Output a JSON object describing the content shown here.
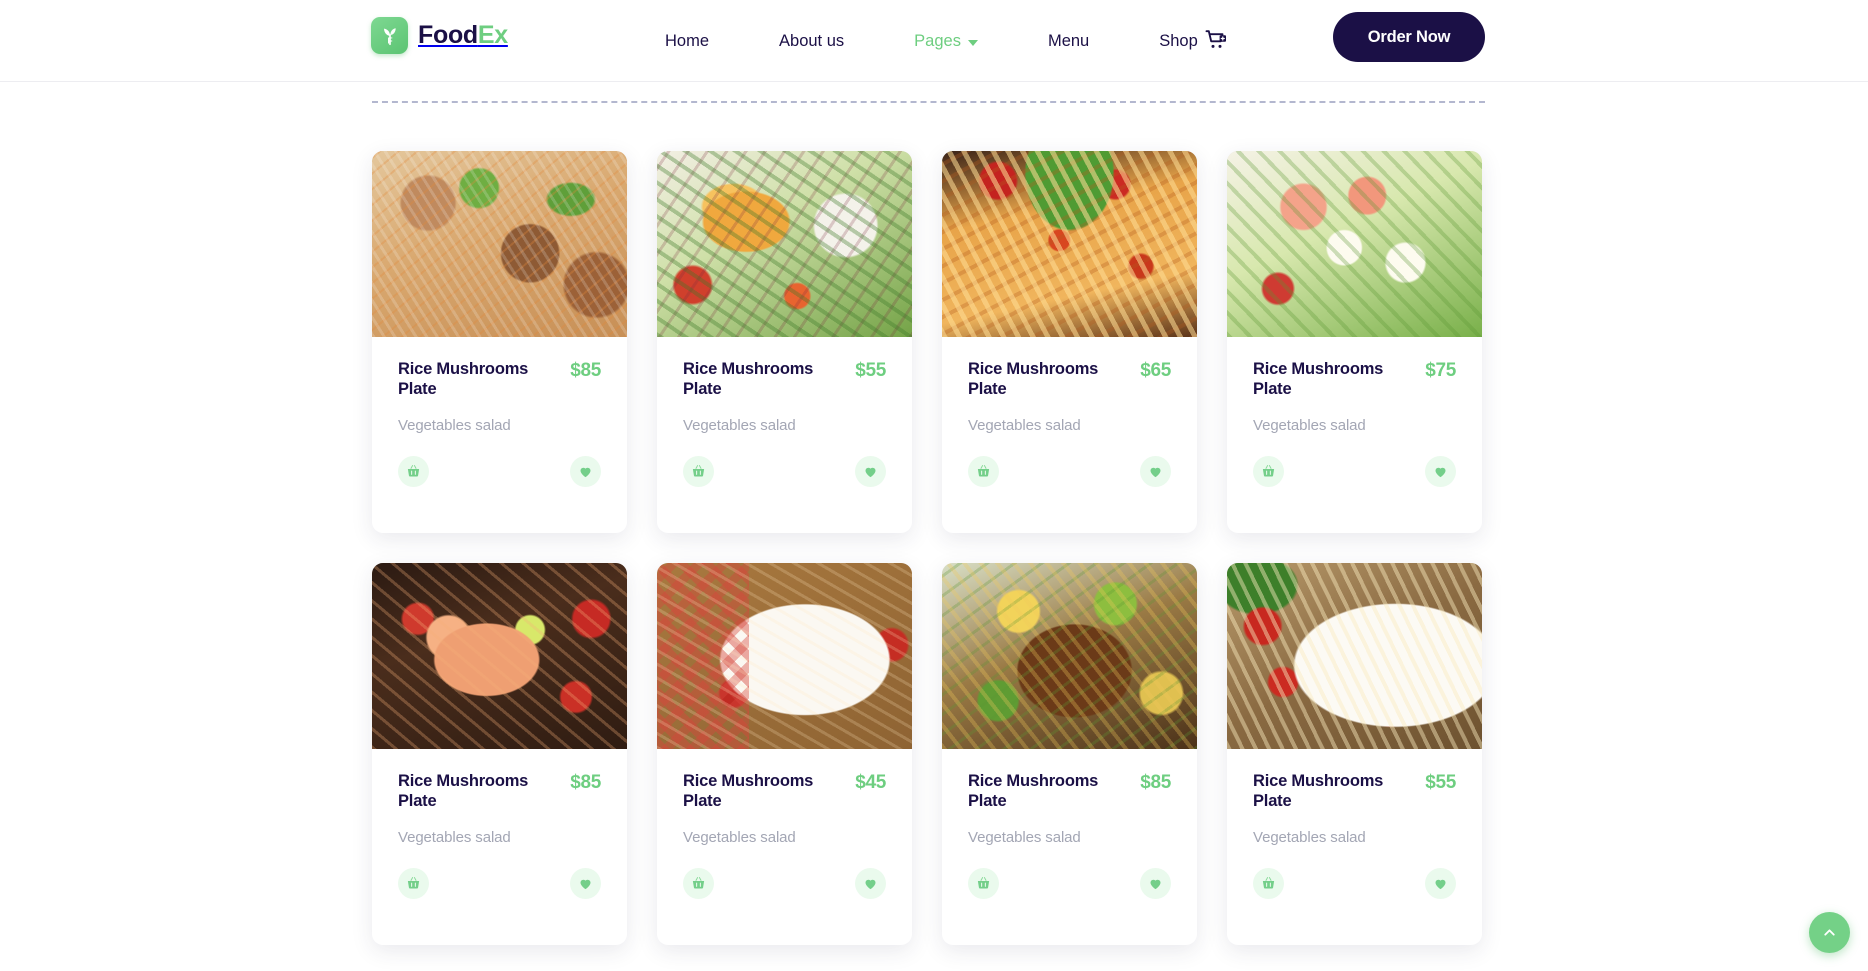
{
  "brand": {
    "name_part1": "Food",
    "name_part2": "Ex",
    "logo_icon": "leaf-sprout-icon",
    "logo_color": "#6ece80"
  },
  "nav": {
    "items": [
      {
        "label": "Home",
        "active": false,
        "has_dropdown": false
      },
      {
        "label": "About us",
        "active": false,
        "has_dropdown": false
      },
      {
        "label": "Pages",
        "active": true,
        "has_dropdown": true
      },
      {
        "label": "Menu",
        "active": false,
        "has_dropdown": false
      },
      {
        "label": "Shop",
        "active": false,
        "has_dropdown": false
      }
    ],
    "cart_icon": "shopping-cart-add-icon",
    "order_button_label": "Order Now",
    "active_color": "#6ece80",
    "text_color": "#1b1046"
  },
  "products": [
    {
      "title": "Rice Mushrooms Plate",
      "price": "$85",
      "subtitle": "Vegetables salad",
      "image_alt": "rice-with-beef-and-herbs",
      "cart_icon": "basket-icon",
      "fav_icon": "heart-icon"
    },
    {
      "title": "Rice Mushrooms Plate",
      "price": "$55",
      "subtitle": "Vegetables salad",
      "image_alt": "grilled-salmon-with-salad",
      "cart_icon": "basket-icon",
      "fav_icon": "heart-icon"
    },
    {
      "title": "Rice Mushrooms Plate",
      "price": "$65",
      "subtitle": "Vegetables salad",
      "image_alt": "penne-pasta-with-tomatoes",
      "cart_icon": "basket-icon",
      "fav_icon": "heart-icon"
    },
    {
      "title": "Rice Mushrooms Plate",
      "price": "$75",
      "subtitle": "Vegetables salad",
      "image_alt": "shrimp-and-egg-salad",
      "cart_icon": "basket-icon",
      "fav_icon": "heart-icon"
    },
    {
      "title": "Rice Mushrooms Plate",
      "price": "$85",
      "subtitle": "Vegetables salad",
      "image_alt": "shrimp-seafood-bowl",
      "cart_icon": "basket-icon",
      "fav_icon": "heart-icon"
    },
    {
      "title": "Rice Mushrooms Plate",
      "price": "$45",
      "subtitle": "Vegetables salad",
      "image_alt": "glazed-chicken-wings",
      "cart_icon": "basket-icon",
      "fav_icon": "heart-icon"
    },
    {
      "title": "Rice Mushrooms Plate",
      "price": "$85",
      "subtitle": "Vegetables salad",
      "image_alt": "roasted-chicken-with-herbs",
      "cart_icon": "basket-icon",
      "fav_icon": "heart-icon"
    },
    {
      "title": "Rice Mushrooms Plate",
      "price": "$55",
      "subtitle": "Vegetables salad",
      "image_alt": "meatball-penne-pasta",
      "cart_icon": "basket-icon",
      "fav_icon": "heart-icon"
    }
  ],
  "scroll_top": {
    "icon": "chevron-up-icon",
    "color": "#74d187"
  },
  "theme": {
    "accent_green": "#6ece80",
    "dark_navy": "#1b1046",
    "muted_text": "#a3a6b4",
    "card_bg": "#ffffff",
    "icon_circle_bg": "#eafaed"
  }
}
